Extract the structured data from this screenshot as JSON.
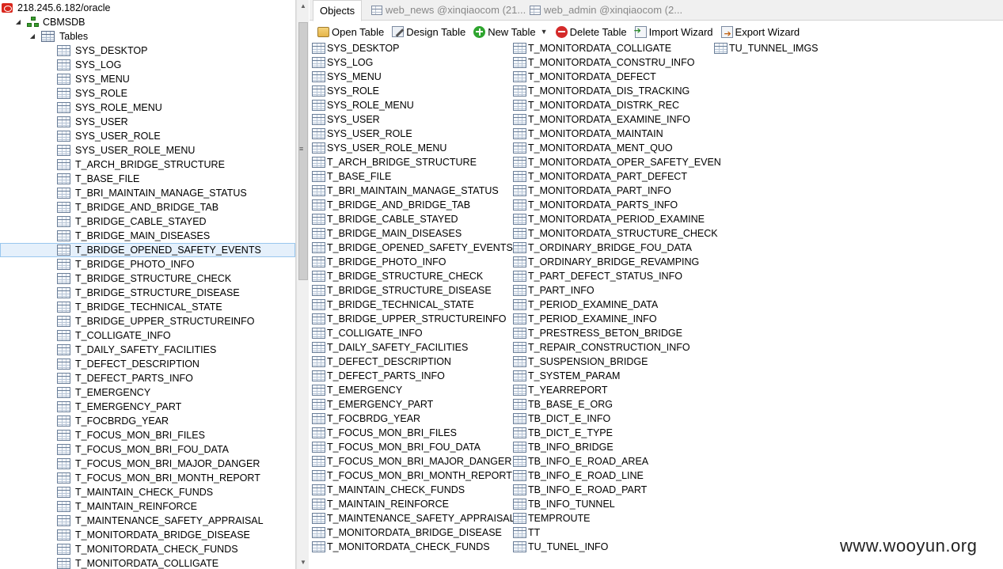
{
  "tree": {
    "server": "218.245.6.182/oracle",
    "database": "CBMSDB",
    "tables_node": "Tables",
    "selected_index": 14,
    "items": [
      "SYS_DESKTOP",
      "SYS_LOG",
      "SYS_MENU",
      "SYS_ROLE",
      "SYS_ROLE_MENU",
      "SYS_USER",
      "SYS_USER_ROLE",
      "SYS_USER_ROLE_MENU",
      "T_ARCH_BRIDGE_STRUCTURE",
      "T_BASE_FILE",
      "T_BRI_MAINTAIN_MANAGE_STATUS",
      "T_BRIDGE_AND_BRIDGE_TAB",
      "T_BRIDGE_CABLE_STAYED",
      "T_BRIDGE_MAIN_DISEASES",
      "T_BRIDGE_OPENED_SAFETY_EVENTS",
      "T_BRIDGE_PHOTO_INFO",
      "T_BRIDGE_STRUCTURE_CHECK",
      "T_BRIDGE_STRUCTURE_DISEASE",
      "T_BRIDGE_TECHNICAL_STATE",
      "T_BRIDGE_UPPER_STRUCTUREINFO",
      "T_COLLIGATE_INFO",
      "T_DAILY_SAFETY_FACILITIES",
      "T_DEFECT_DESCRIPTION",
      "T_DEFECT_PARTS_INFO",
      "T_EMERGENCY",
      "T_EMERGENCY_PART",
      "T_FOCBRDG_YEAR",
      "T_FOCUS_MON_BRI_FILES",
      "T_FOCUS_MON_BRI_FOU_DATA",
      "T_FOCUS_MON_BRI_MAJOR_DANGER",
      "T_FOCUS_MON_BRI_MONTH_REPORT",
      "T_MAINTAIN_CHECK_FUNDS",
      "T_MAINTAIN_REINFORCE",
      "T_MAINTENANCE_SAFETY_APPRAISAL",
      "T_MONITORDATA_BRIDGE_DISEASE",
      "T_MONITORDATA_CHECK_FUNDS",
      "T_MONITORDATA_COLLIGATE"
    ]
  },
  "tabs": [
    {
      "label": "Objects",
      "active": true
    },
    {
      "label": "web_news @xinqiaocom (21...",
      "active": false
    },
    {
      "label": "web_admin @xinqiaocom (2...",
      "active": false
    }
  ],
  "toolbar": {
    "open_table": "Open Table",
    "design_table": "Design Table",
    "new_table": "New Table",
    "delete_table": "Delete Table",
    "import_wizard": "Import Wizard",
    "export_wizard": "Export Wizard"
  },
  "objects": {
    "col1": [
      "SYS_DESKTOP",
      "SYS_LOG",
      "SYS_MENU",
      "SYS_ROLE",
      "SYS_ROLE_MENU",
      "SYS_USER",
      "SYS_USER_ROLE",
      "SYS_USER_ROLE_MENU",
      "T_ARCH_BRIDGE_STRUCTURE",
      "T_BASE_FILE",
      "T_BRI_MAINTAIN_MANAGE_STATUS",
      "T_BRIDGE_AND_BRIDGE_TAB",
      "T_BRIDGE_CABLE_STAYED",
      "T_BRIDGE_MAIN_DISEASES",
      "T_BRIDGE_OPENED_SAFETY_EVENTS",
      "T_BRIDGE_PHOTO_INFO",
      "T_BRIDGE_STRUCTURE_CHECK",
      "T_BRIDGE_STRUCTURE_DISEASE",
      "T_BRIDGE_TECHNICAL_STATE",
      "T_BRIDGE_UPPER_STRUCTUREINFO",
      "T_COLLIGATE_INFO",
      "T_DAILY_SAFETY_FACILITIES",
      "T_DEFECT_DESCRIPTION",
      "T_DEFECT_PARTS_INFO",
      "T_EMERGENCY",
      "T_EMERGENCY_PART",
      "T_FOCBRDG_YEAR",
      "T_FOCUS_MON_BRI_FILES",
      "T_FOCUS_MON_BRI_FOU_DATA",
      "T_FOCUS_MON_BRI_MAJOR_DANGER",
      "T_FOCUS_MON_BRI_MONTH_REPORT",
      "T_MAINTAIN_CHECK_FUNDS",
      "T_MAINTAIN_REINFORCE",
      "T_MAINTENANCE_SAFETY_APPRAISAL",
      "T_MONITORDATA_BRIDGE_DISEASE",
      "T_MONITORDATA_CHECK_FUNDS"
    ],
    "col2": [
      "T_MONITORDATA_COLLIGATE",
      "T_MONITORDATA_CONSTRU_INFO",
      "T_MONITORDATA_DEFECT",
      "T_MONITORDATA_DIS_TRACKING",
      "T_MONITORDATA_DISTRK_REC",
      "T_MONITORDATA_EXAMINE_INFO",
      "T_MONITORDATA_MAINTAIN",
      "T_MONITORDATA_MENT_QUO",
      "T_MONITORDATA_OPER_SAFETY_EVEN",
      "T_MONITORDATA_PART_DEFECT",
      "T_MONITORDATA_PART_INFO",
      "T_MONITORDATA_PARTS_INFO",
      "T_MONITORDATA_PERIOD_EXAMINE",
      "T_MONITORDATA_STRUCTURE_CHECK",
      "T_ORDINARY_BRIDGE_FOU_DATA",
      "T_ORDINARY_BRIDGE_REVAMPING",
      "T_PART_DEFECT_STATUS_INFO",
      "T_PART_INFO",
      "T_PERIOD_EXAMINE_DATA",
      "T_PERIOD_EXAMINE_INFO",
      "T_PRESTRESS_BETON_BRIDGE",
      "T_REPAIR_CONSTRUCTION_INFO",
      "T_SUSPENSION_BRIDGE",
      "T_SYSTEM_PARAM",
      "T_YEARREPORT",
      "TB_BASE_E_ORG",
      "TB_DICT_E_INFO",
      "TB_DICT_E_TYPE",
      "TB_INFO_BRIDGE",
      "TB_INFO_E_ROAD_AREA",
      "TB_INFO_E_ROAD_LINE",
      "TB_INFO_E_ROAD_PART",
      "TB_INFO_TUNNEL",
      "TEMPROUTE",
      "TT",
      "TU_TUNEL_INFO"
    ],
    "col3": [
      "TU_TUNNEL_IMGS"
    ]
  },
  "watermark": "www.wooyun.org"
}
